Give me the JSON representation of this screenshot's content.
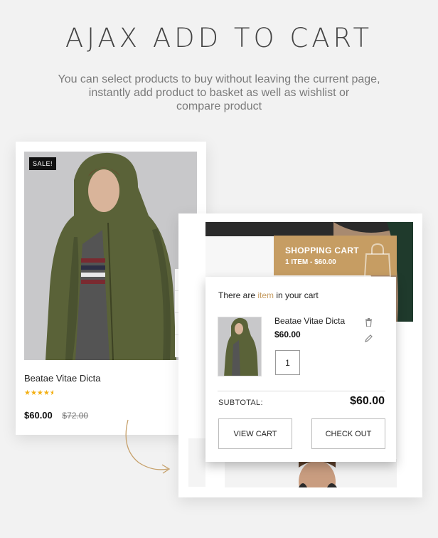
{
  "header": {
    "title": "AJAX ADD TO CART",
    "subtitle_line1": "You can select products to buy without leaving the current page,",
    "subtitle_line2": "instantly add product to basket as well as wishlist or",
    "subtitle_line3": "compare product"
  },
  "product_card": {
    "badge": "SALE!",
    "name": "Beatae Vitae Dicta",
    "rating_stars": 4.5,
    "price": "$60.00",
    "old_price": "$72.00",
    "actions": [
      "cart-icon",
      "heart-icon",
      "compare-icon",
      "search-icon"
    ]
  },
  "cart": {
    "header_title": "SHOPPING CART",
    "header_summary": "1 ITEM - $60.00",
    "message_prefix": "There are ",
    "message_accent": "item",
    "message_suffix": " in your cart",
    "item_name": "Beatae Vitae Dicta",
    "item_price": "$60.00",
    "item_qty": "1",
    "subtotal_label": "SUBTOTAL:",
    "subtotal_value": "$60.00",
    "view_cart_label": "VIEW CART",
    "checkout_label": "CHECK OUT"
  },
  "colors": {
    "accent": "#c69d63",
    "badge_bg": "#111111",
    "star": "#f3b014",
    "check": "#5bb02c"
  }
}
